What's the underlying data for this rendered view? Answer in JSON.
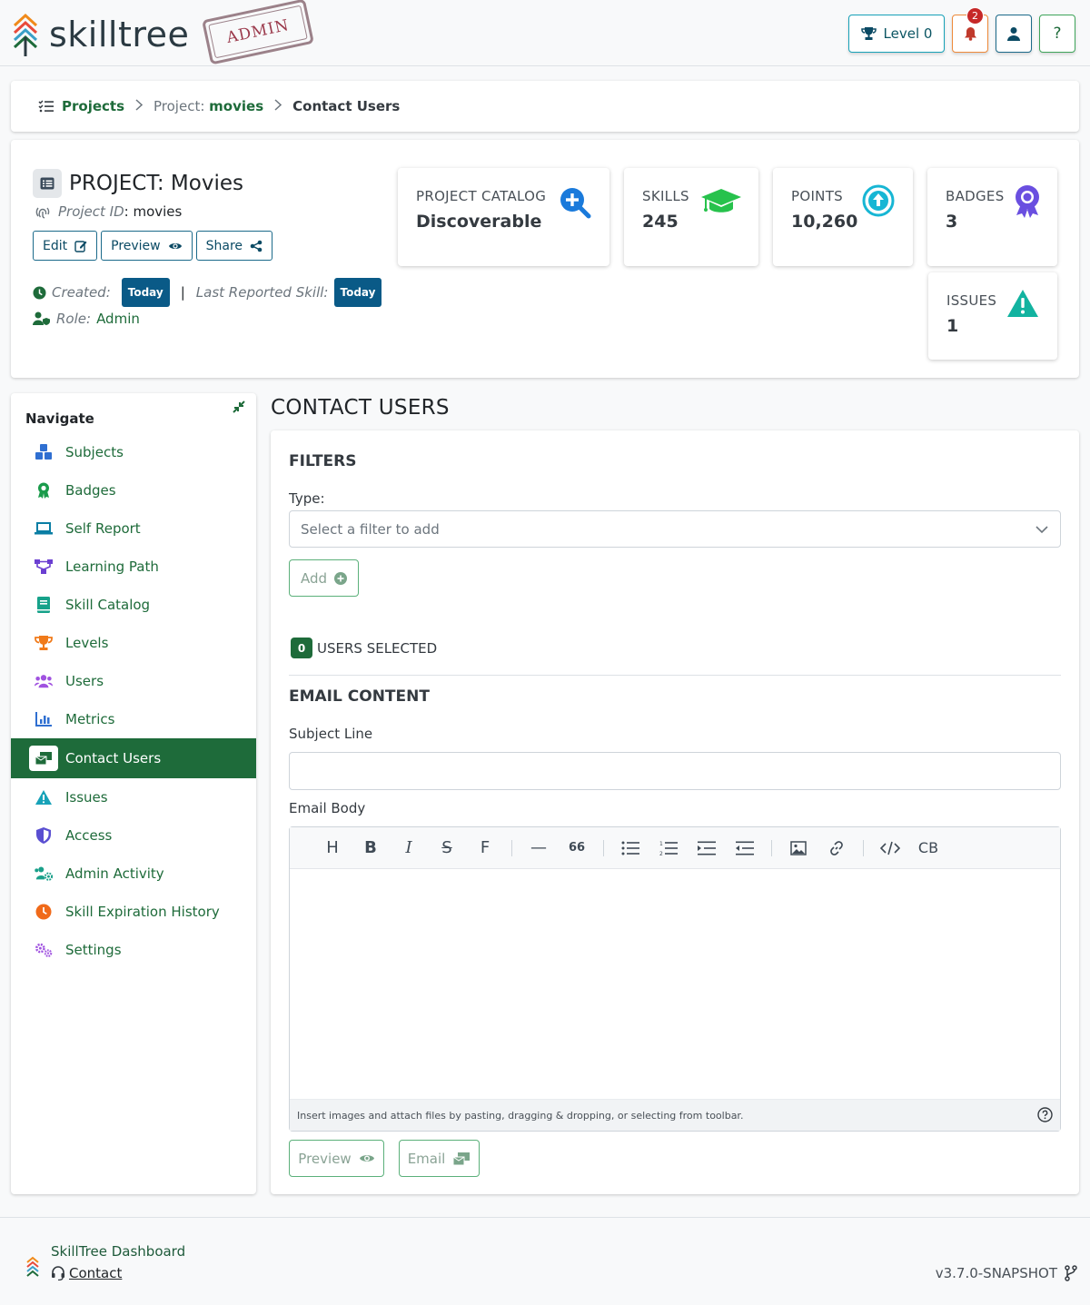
{
  "header": {
    "logo_text": "skilltree",
    "stamp_text": "ADMIN",
    "level_label": "Level 0",
    "notification_count": "2",
    "help_label": "?"
  },
  "breadcrumb": {
    "projects": "Projects",
    "project_prefix": "Project:",
    "project_name": "movies",
    "current": "Contact Users"
  },
  "project": {
    "title": "PROJECT: Movies",
    "id_label": "Project ID",
    "id_value": ": movies",
    "buttons": {
      "edit": "Edit",
      "preview": "Preview",
      "share": "Share"
    },
    "created_label": "Created:",
    "created_value": "Today",
    "separator": "|",
    "last_reported_label": "Last Reported Skill:",
    "last_reported_value": "Today",
    "role_label": "Role:",
    "role_value": "Admin"
  },
  "stats": {
    "catalog": {
      "label": "PROJECT CATALOG",
      "value": "Discoverable"
    },
    "skills": {
      "label": "SKILLS",
      "value": "245"
    },
    "points": {
      "label": "POINTS",
      "value": "10,260"
    },
    "badges": {
      "label": "BADGES",
      "value": "3"
    },
    "issues": {
      "label": "ISSUES",
      "value": "1"
    }
  },
  "sidebar": {
    "title": "Navigate",
    "items": [
      {
        "label": "Subjects",
        "icon": "cubes-icon",
        "color": "#2f6fd1"
      },
      {
        "label": "Badges",
        "icon": "award-icon",
        "color": "#1a9b4b"
      },
      {
        "label": "Self Report",
        "icon": "laptop-icon",
        "color": "#0a7ea4"
      },
      {
        "label": "Learning Path",
        "icon": "network-icon",
        "color": "#6b3fd1"
      },
      {
        "label": "Skill Catalog",
        "icon": "book-icon",
        "color": "#17a28a"
      },
      {
        "label": "Levels",
        "icon": "trophy-icon",
        "color": "#f07a1a"
      },
      {
        "label": "Users",
        "icon": "users-icon",
        "color": "#a052e0"
      },
      {
        "label": "Metrics",
        "icon": "chart-icon",
        "color": "#2f6fd1"
      },
      {
        "label": "Contact Users",
        "icon": "mail-bulk-icon",
        "color": "#1e6b3a"
      },
      {
        "label": "Issues",
        "icon": "warning-icon",
        "color": "#17a2b8"
      },
      {
        "label": "Access",
        "icon": "shield-icon",
        "color": "#5a4fd1"
      },
      {
        "label": "Admin Activity",
        "icon": "users-cog-icon",
        "color": "#1aa08a"
      },
      {
        "label": "Skill Expiration History",
        "icon": "clock-icon",
        "color": "#f06a1a"
      },
      {
        "label": "Settings",
        "icon": "cogs-icon",
        "color": "#a052e0"
      }
    ]
  },
  "main": {
    "title": "CONTACT USERS",
    "filters_title": "FILTERS",
    "type_label": "Type:",
    "select_placeholder": "Select a filter to add",
    "add_label": "Add",
    "users_selected_count": "0",
    "users_selected_label": "USERS SELECTED",
    "email_content_title": "EMAIL CONTENT",
    "subject_label": "Subject Line",
    "subject_value": "",
    "body_label": "Email Body",
    "toolbar": [
      "H",
      "B",
      "I",
      "S",
      "F",
      "—",
      "66",
      "ul",
      "ol",
      "indent",
      "outdent",
      "image",
      "link",
      "code",
      "CB"
    ],
    "editor_hint": "Insert images and attach files by pasting, dragging & dropping, or selecting from toolbar.",
    "preview_label": "Preview",
    "email_label": "Email"
  },
  "footer": {
    "name": "SkillTree Dashboard",
    "contact": "Contact",
    "version": "v3.7.0-SNAPSHOT"
  }
}
